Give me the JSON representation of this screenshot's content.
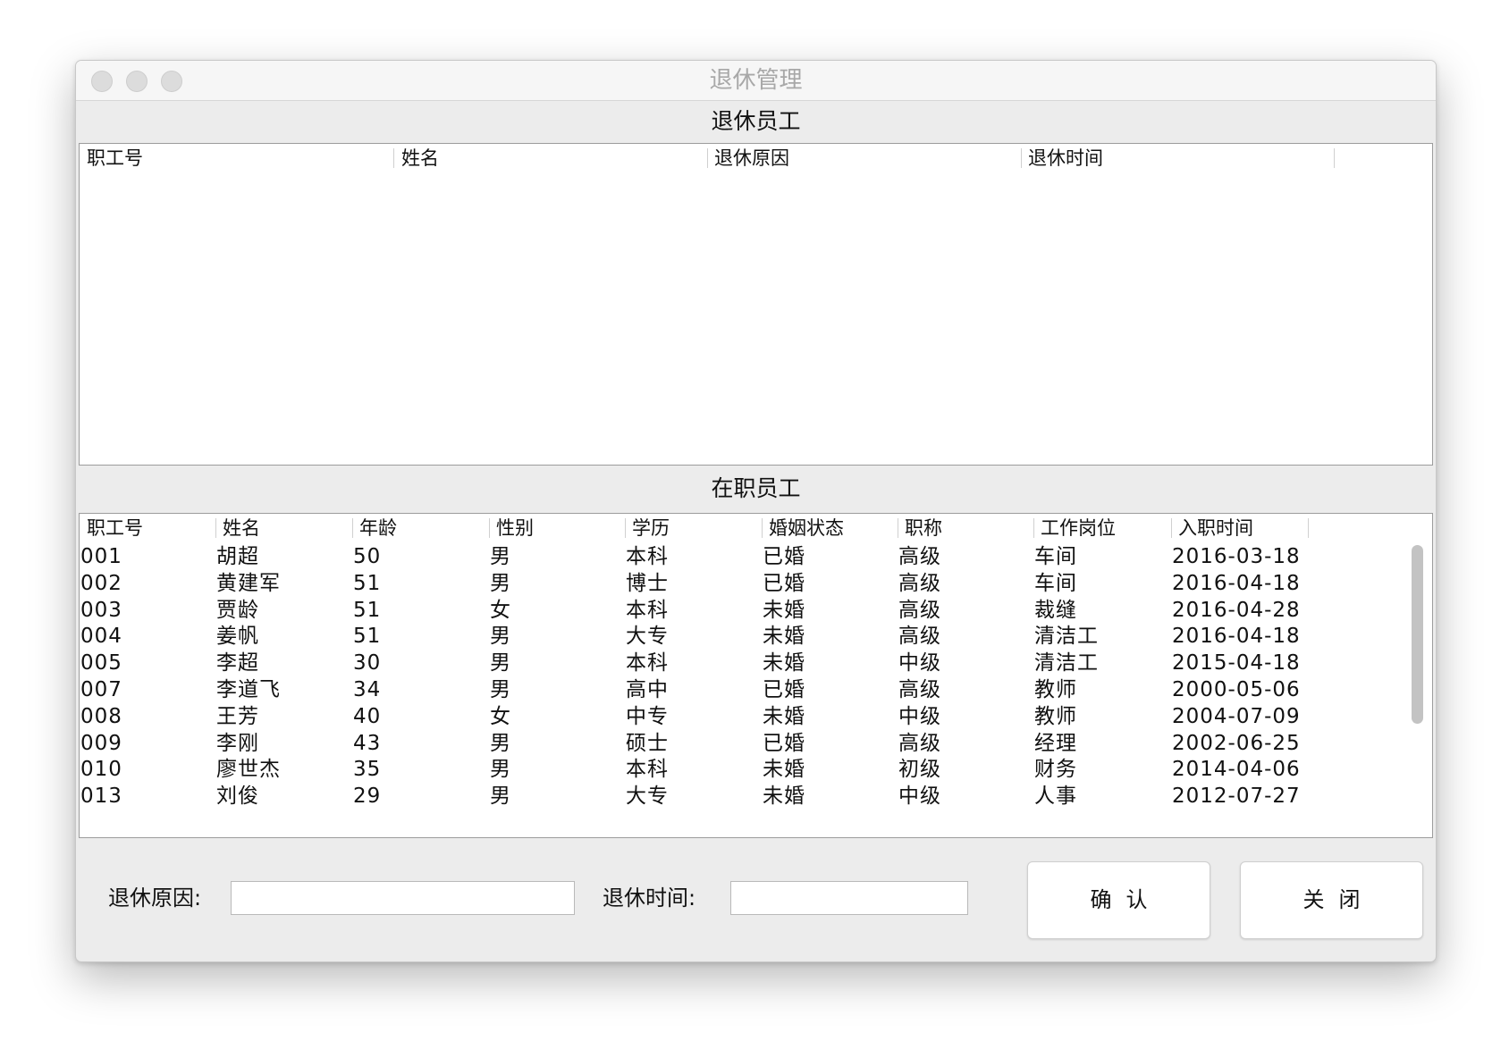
{
  "window": {
    "title": "退休管理",
    "traffic_lights": [
      "close",
      "minimize",
      "zoom"
    ]
  },
  "retired_section": {
    "label": "退休员工",
    "columns": [
      "职工号",
      "姓名",
      "退休原因",
      "退休时间"
    ],
    "rows": []
  },
  "active_section": {
    "label": "在职员工",
    "columns": [
      "职工号",
      "姓名",
      "年龄",
      "性别",
      "学历",
      "婚姻状态",
      "职称",
      "工作岗位",
      "入职时间"
    ],
    "rows": [
      [
        "001",
        "胡超",
        "50",
        "男",
        "本科",
        "已婚",
        "高级",
        "车间",
        "2016-03-18"
      ],
      [
        "002",
        "黄建军",
        "51",
        "男",
        "博士",
        "已婚",
        "高级",
        "车间",
        "2016-04-18"
      ],
      [
        "003",
        "贾龄",
        "51",
        "女",
        "本科",
        "未婚",
        "高级",
        "裁缝",
        "2016-04-28"
      ],
      [
        "004",
        "姜帆",
        "51",
        "男",
        "大专",
        "未婚",
        "高级",
        "清洁工",
        "2016-04-18"
      ],
      [
        "005",
        "李超",
        "30",
        "男",
        "本科",
        "未婚",
        "中级",
        "清洁工",
        "2015-04-18"
      ],
      [
        "007",
        "李道飞",
        "34",
        "男",
        "高中",
        "已婚",
        "高级",
        "教师",
        "2000-05-06"
      ],
      [
        "008",
        "王芳",
        "40",
        "女",
        "中专",
        "未婚",
        "中级",
        "教师",
        "2004-07-09"
      ],
      [
        "009",
        "李刚",
        "43",
        "男",
        "硕士",
        "已婚",
        "高级",
        "经理",
        "2002-06-25"
      ],
      [
        "010",
        "廖世杰",
        "35",
        "男",
        "本科",
        "未婚",
        "初级",
        "财务",
        "2014-04-06"
      ],
      [
        "013",
        "刘俊",
        "29",
        "男",
        "大专",
        "未婚",
        "中级",
        "人事",
        "2012-07-27"
      ]
    ]
  },
  "form": {
    "reason_label": "退休原因:",
    "reason_value": "",
    "time_label": "退休时间:",
    "time_value": "",
    "confirm_label": "确认",
    "close_label": "关闭"
  }
}
